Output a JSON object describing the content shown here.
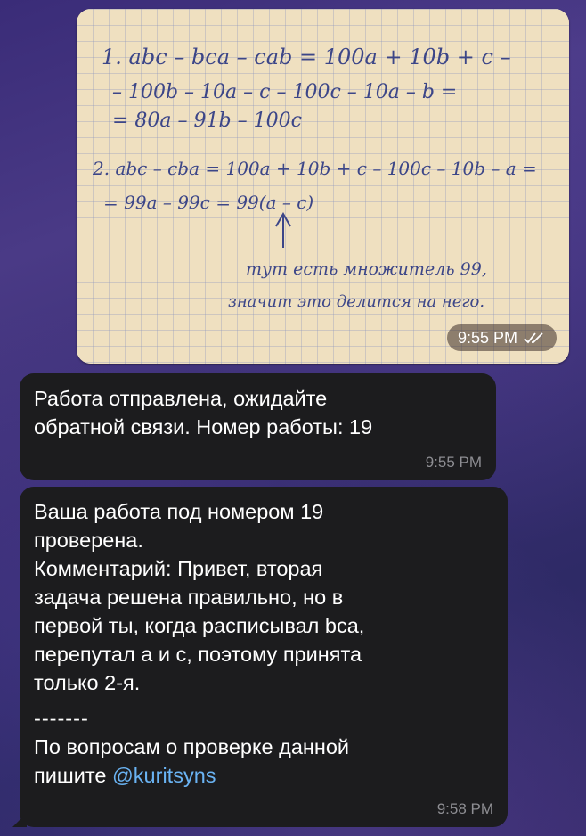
{
  "photo": {
    "handwriting": {
      "line1": "1.  abc – bca – cab = 100a + 10b + c –",
      "line2": "– 100b – 10a – c – 100c – 10a – b =",
      "line3": "= 80a – 91b – 100c",
      "line4": "2.  abc – cba = 100a + 10b + c – 100c – 10b – a =",
      "line5": "= 99a – 99c = 99(a – c)",
      "note1": "тут есть множитель 99,",
      "note2": "значит это делится на него."
    },
    "time": "9:55 PM"
  },
  "messages": [
    {
      "lines": [
        "Работа отправлена, ожидайте",
        "обратной связи. Номер работы: 19"
      ],
      "time": "9:55 PM"
    },
    {
      "lines": [
        "Ваша работа под номером 19",
        "проверена.",
        "Комментарий: Привет, вторая",
        "задача решена правильно, но в",
        "первой ты, когда расписывал bca,",
        "перепутал а и с, поэтому принята",
        "только 2-я."
      ],
      "separator": "-------",
      "footer_line1": "По вопросам о проверке данной",
      "footer_prefix": "пишите ",
      "mention": "@kuritsyns",
      "time": "9:58 PM"
    }
  ],
  "colors": {
    "bubble": "#1c1c1e",
    "time": "#8e8e93",
    "mention": "#6ab3f3",
    "handwriting_ink": "#3c4688"
  }
}
